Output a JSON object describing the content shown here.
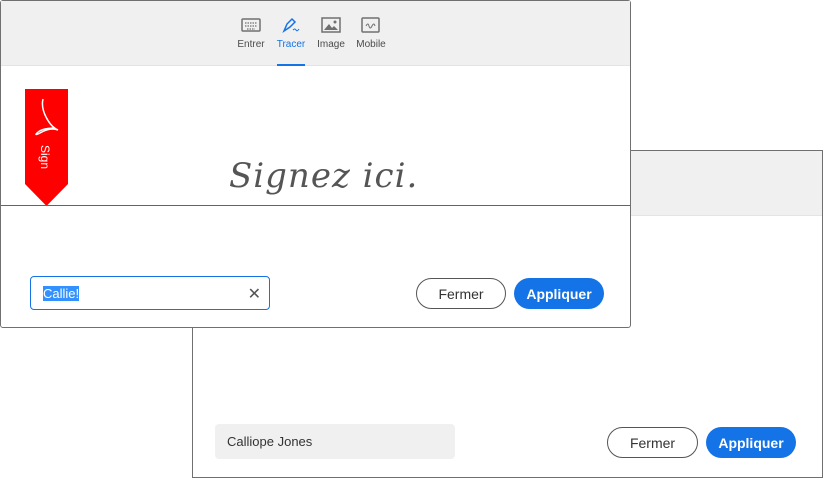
{
  "tabs": [
    {
      "label": "Entrer",
      "icon": "keyboard-icon"
    },
    {
      "label": "Tracer",
      "icon": "pen-icon",
      "active": true
    },
    {
      "label": "Image",
      "icon": "image-icon"
    },
    {
      "label": "Mobile",
      "icon": "mobile-icon"
    }
  ],
  "ribbon": {
    "label": "Sign"
  },
  "signature": {
    "placeholder": "Signez ici."
  },
  "front": {
    "name_value": "Callie!",
    "close_label": "Fermer",
    "apply_label": "Appliquer"
  },
  "back": {
    "name_value": "Calliope Jones",
    "close_label": "Fermer",
    "apply_label": "Appliquer"
  },
  "colors": {
    "accent": "#1473e6",
    "ribbon": "#ff0000"
  }
}
